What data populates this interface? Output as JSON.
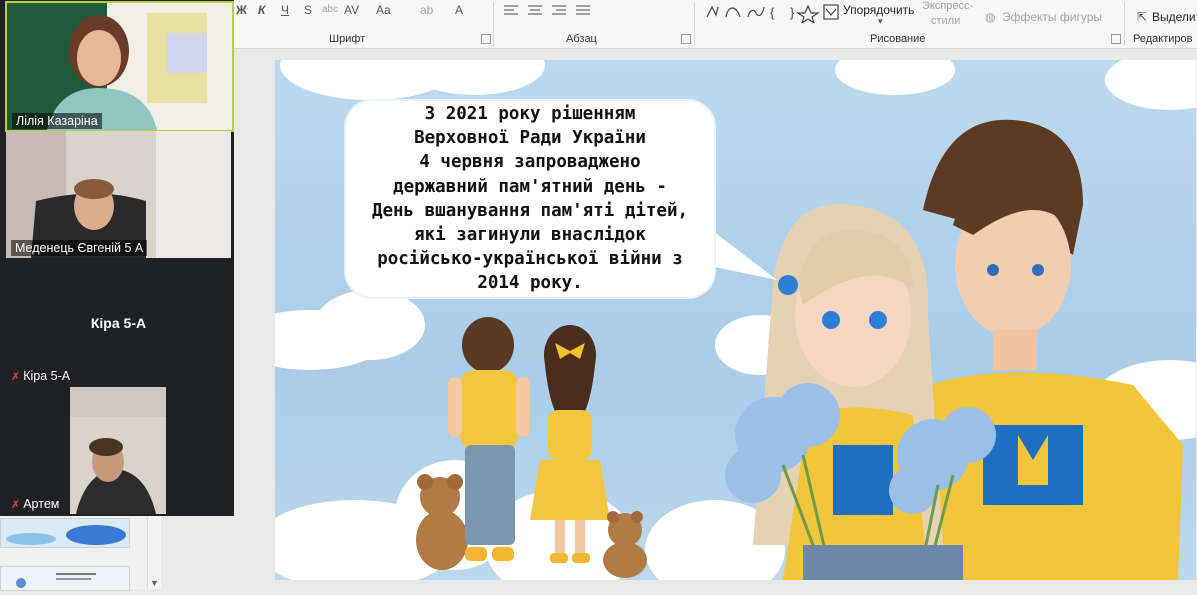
{
  "ribbon": {
    "groups": [
      {
        "id": "font",
        "label": "Шрифт"
      },
      {
        "id": "paragraph",
        "label": "Абзац"
      },
      {
        "id": "drawing",
        "label": "Рисование"
      },
      {
        "id": "editing",
        "label": "Редактиров"
      }
    ],
    "font_buttons": [
      "Ж",
      "К",
      "Ч",
      "S",
      "AV",
      "Aa",
      "A"
    ],
    "arrange_label": "Упорядочить",
    "quick_styles_label_1": "Экспресс-",
    "quick_styles_label_2": "стили",
    "shape_effects_label": "Эффекты фигуры",
    "select_label": "Выделить"
  },
  "participants": [
    {
      "name": "Лілія Казаріна",
      "video": true,
      "active": true,
      "muted": false
    },
    {
      "name": "Меденець Євгеній 5 А",
      "video": true,
      "active": false,
      "muted": false
    },
    {
      "name": "Кіра 5-А",
      "video": false,
      "active": false,
      "muted": true,
      "center_name": "Кіра 5-А"
    },
    {
      "name": "Артем",
      "video": true,
      "active": false,
      "muted": true
    }
  ],
  "slide": {
    "bubble_lines": [
      "З 2021 року рішенням",
      "Верховної Ради України",
      "4 червня запроваджено",
      "державний пам'ятний день -",
      "День вшанування пам'яті дітей,",
      "які загинули внаслідок",
      "російсько-української війни з",
      "2014 року."
    ]
  },
  "colors": {
    "active_speaker_border": "#b8cf42",
    "muted_icon": "#e0463a",
    "slide_sky": "#a9cdea",
    "shirt_yellow": "#f2c53a",
    "flag_blue": "#1f6fc0"
  }
}
